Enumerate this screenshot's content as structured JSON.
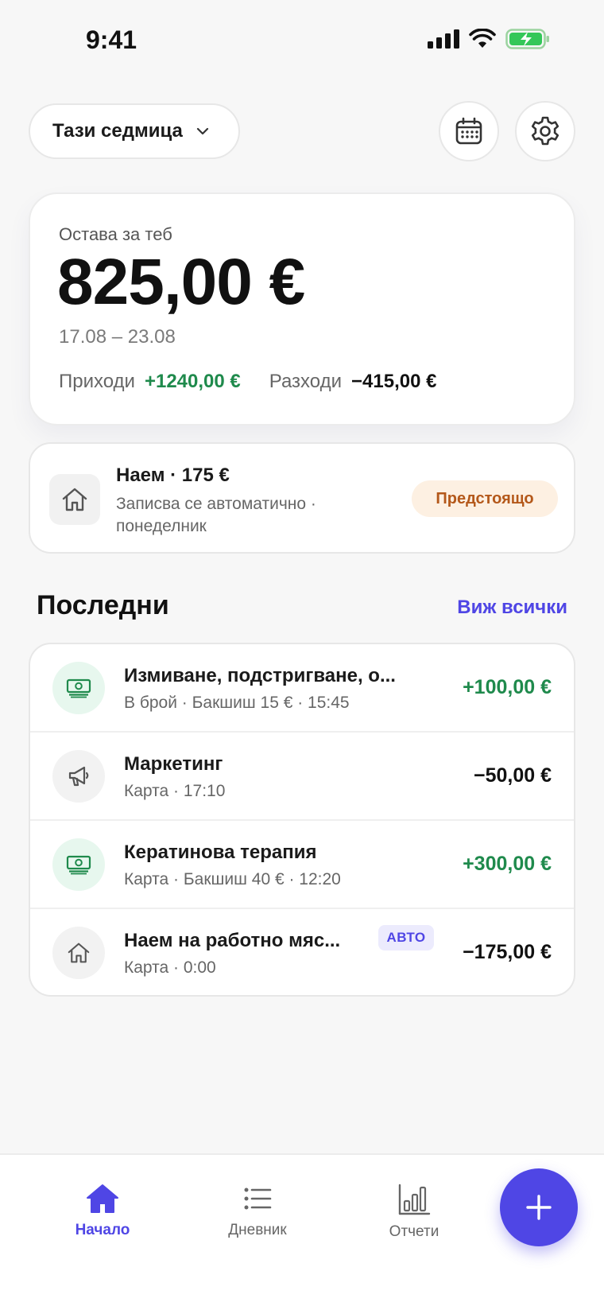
{
  "status": {
    "time": "9:41"
  },
  "header": {
    "period_label": "Тази седмица"
  },
  "balance": {
    "label": "Остава за теб",
    "amount": "825,00 €",
    "dates": "17.08 – 23.08",
    "income_label": "Приходи",
    "income_value": "+1240,00 €",
    "expense_label": "Разходи",
    "expense_value": "−415,00 €"
  },
  "upcoming": {
    "title": "Наем · 175 €",
    "subtitle": "Записва се автоматично · понеделник",
    "badge": "Предстоящо",
    "icon": "home-icon"
  },
  "recent": {
    "title": "Последни",
    "see_all": "Виж всички",
    "items": [
      {
        "title": "Измиване, подстригване, о...",
        "subtitle": "В брой · Бакшиш 15 € · 15:45",
        "amount": "+100,00 €",
        "kind": "income",
        "icon": "cash-icon"
      },
      {
        "title": "Маркетинг",
        "subtitle": "Карта · 17:10",
        "amount": "−50,00 €",
        "kind": "expense",
        "icon": "megaphone-icon"
      },
      {
        "title": "Кератинова терапия",
        "subtitle": "Карта · Бакшиш 40 € · 12:20",
        "amount": "+300,00 €",
        "kind": "income",
        "icon": "cash-icon"
      },
      {
        "title": "Наем на работно мяс...",
        "subtitle": "Карта · 0:00",
        "amount": "−175,00 €",
        "kind": "expense",
        "icon": "home-icon",
        "badge": "АВТО"
      }
    ]
  },
  "nav": {
    "home": "Начало",
    "journal": "Дневник",
    "reports": "Отчети"
  },
  "colors": {
    "accent": "#4f46e5",
    "income": "#1f8a4c",
    "upcoming": "#b4581a"
  }
}
